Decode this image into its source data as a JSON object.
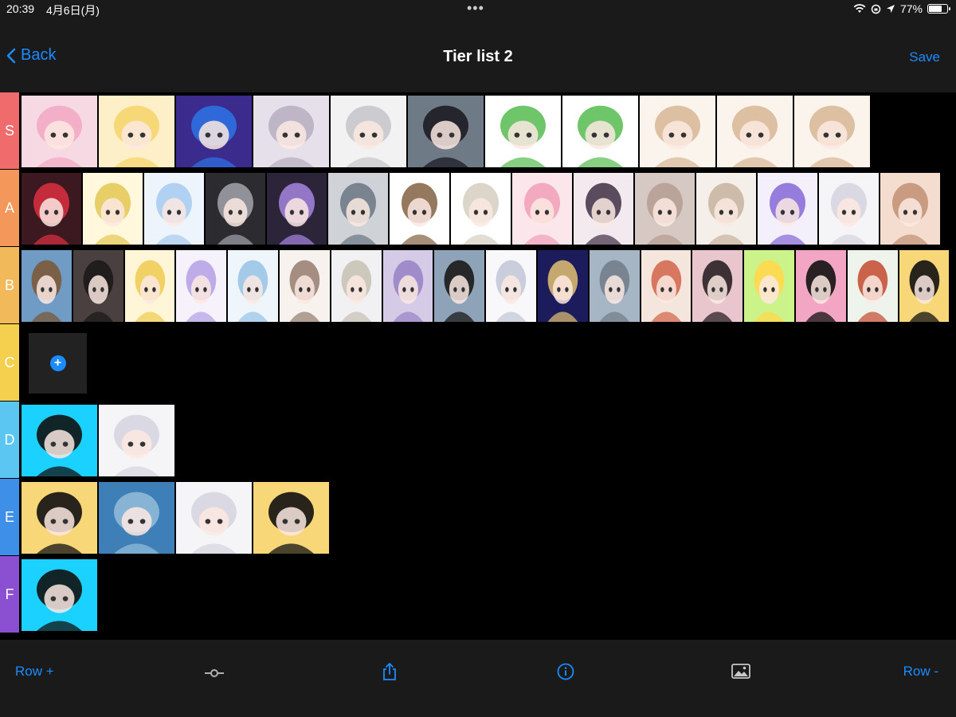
{
  "status": {
    "time": "20:39",
    "date": "4月6日(月)",
    "battery": "77%",
    "battery_level": 0.77
  },
  "nav": {
    "back": "Back",
    "title": "Tier list 2",
    "save": "Save"
  },
  "icons": {
    "back": "chevron-left-icon",
    "add": "plus-icon",
    "slider": "slider-icon",
    "share": "share-icon",
    "info": "info-icon",
    "image": "image-icon",
    "wifi": "wifi-icon",
    "orientation_lock": "orientation-lock-icon",
    "location": "location-icon",
    "battery": "battery-icon"
  },
  "tiers": [
    {
      "label": "S",
      "color": "#f06c6c",
      "items": [
        {
          "name": "pink-chibi",
          "bg": "#f7d9e4",
          "fg": "#f2a9c4"
        },
        {
          "name": "blonde-girl",
          "bg": "#fdf0c8",
          "fg": "#f6d56e"
        },
        {
          "name": "blue-haired",
          "bg": "#3a2b8c",
          "fg": "#2f6fe0"
        },
        {
          "name": "silver-haired",
          "bg": "#e6e0ea",
          "fg": "#b9b0c2"
        },
        {
          "name": "white-haired",
          "bg": "#f2f2f2",
          "fg": "#c8c8cc"
        },
        {
          "name": "photo-girl",
          "bg": "#6e7a86",
          "fg": "#1c1c24"
        },
        {
          "name": "green-dino",
          "bg": "#ffffff",
          "fg": "#5fbf5a"
        },
        {
          "name": "green-dino",
          "bg": "#ffffff",
          "fg": "#5fbf5a"
        },
        {
          "name": "bunny-girl",
          "bg": "#fbf4ec",
          "fg": "#d9b999"
        },
        {
          "name": "bunny-girl",
          "bg": "#fbf4ec",
          "fg": "#d9b999"
        },
        {
          "name": "bunny-girl",
          "bg": "#fbf4ec",
          "fg": "#d9b999"
        }
      ]
    },
    {
      "label": "A",
      "color": "#f3985a",
      "items": [
        {
          "name": "red-hair",
          "bg": "#3c1820",
          "fg": "#d32f3f"
        },
        {
          "name": "blonde-boy",
          "bg": "#fff8dc",
          "fg": "#e6c95a"
        },
        {
          "name": "light-blue",
          "bg": "#eef4fb",
          "fg": "#a9cdef"
        },
        {
          "name": "grey-wolf",
          "bg": "#2b2b30",
          "fg": "#9c9ca6"
        },
        {
          "name": "purple-dark",
          "bg": "#2c2438",
          "fg": "#9f7fd6"
        },
        {
          "name": "old-man",
          "bg": "#cfd3d8",
          "fg": "#6f7b88"
        },
        {
          "name": "brown-boy",
          "bg": "#ffffff",
          "fg": "#8a6a4e"
        },
        {
          "name": "sketch-boy",
          "bg": "#ffffff",
          "fg": "#d8d2c4"
        },
        {
          "name": "pink-angel",
          "bg": "#fbe6ec",
          "fg": "#f2a3bb"
        },
        {
          "name": "dark-bob",
          "bg": "#f3eaf0",
          "fg": "#4a3a4e"
        },
        {
          "name": "beige-girl",
          "bg": "#d6c8c2",
          "fg": "#b79f93"
        },
        {
          "name": "mint-bunny",
          "bg": "#f4efe9",
          "fg": "#c9b6a2"
        },
        {
          "name": "purple-boy",
          "bg": "#f3f0fb",
          "fg": "#8c6fd8"
        },
        {
          "name": "white-boy",
          "bg": "#f5f5f8",
          "fg": "#d7d5e0"
        },
        {
          "name": "brown-girl",
          "bg": "#f4dccf",
          "fg": "#c49478"
        }
      ]
    },
    {
      "label": "B",
      "color": "#f2b95a",
      "items": [
        {
          "name": "landscape",
          "bg": "#6f9bc4",
          "fg": "#7a5a3a"
        },
        {
          "name": "photo-girl-dark",
          "bg": "#4a4040",
          "fg": "#1e1a1a"
        },
        {
          "name": "blonde-wink",
          "bg": "#fff6d8",
          "fg": "#f0cd58"
        },
        {
          "name": "lavender-boy",
          "bg": "#f5f2fb",
          "fg": "#b7a4e6"
        },
        {
          "name": "penguin-hood",
          "bg": "#eef5fb",
          "fg": "#9bc5e8"
        },
        {
          "name": "cat-ears",
          "bg": "#f7f2ee",
          "fg": "#9b8374"
        },
        {
          "name": "blue-eye",
          "bg": "#f1f1f4",
          "fg": "#c9c3b6"
        },
        {
          "name": "purple-fluffy",
          "bg": "#d6cbe6",
          "fg": "#9a85c7"
        },
        {
          "name": "penguin",
          "bg": "#8ea2b8",
          "fg": "#1a1a1a"
        },
        {
          "name": "silver-chibi",
          "bg": "#f8f8fa",
          "fg": "#c4c8d8"
        },
        {
          "name": "night-boy",
          "bg": "#1c1c5c",
          "fg": "#d8b870"
        },
        {
          "name": "default-avatar",
          "bg": "#a7b6c4",
          "fg": "#73808c"
        },
        {
          "name": "red-hood",
          "bg": "#f4e6dc",
          "fg": "#d46a52"
        },
        {
          "name": "photo-girl-pink",
          "bg": "#e9c6cd",
          "fg": "#2a2026"
        },
        {
          "name": "sunglasses-chick",
          "bg": "#ccf38a",
          "fg": "#ffd84a"
        },
        {
          "name": "black-cat",
          "bg": "#f3a6c4",
          "fg": "#121212"
        },
        {
          "name": "red-hair-boy",
          "bg": "#eef3ec",
          "fg": "#c7533a"
        },
        {
          "name": "mickey",
          "bg": "#f7d777",
          "fg": "#111111"
        }
      ]
    },
    {
      "label": "C",
      "color": "#f5cf4e",
      "items": []
    },
    {
      "label": "D",
      "color": "#5ac6f1",
      "items": [
        {
          "name": "mickey-rainbow",
          "bg": "#1ad1ff",
          "fg": "#111111"
        },
        {
          "name": "white-boy",
          "bg": "#f5f5f8",
          "fg": "#d7d5e0"
        }
      ]
    },
    {
      "label": "E",
      "color": "#3d8fe8",
      "items": [
        {
          "name": "mickey",
          "bg": "#f7d777",
          "fg": "#111111"
        },
        {
          "name": "blue-plush",
          "bg": "#3f7fb7",
          "fg": "#8fbad8"
        },
        {
          "name": "white-boy",
          "bg": "#f5f5f8",
          "fg": "#d7d5e0"
        },
        {
          "name": "mickey",
          "bg": "#f7d777",
          "fg": "#111111"
        }
      ]
    },
    {
      "label": "F",
      "color": "#8b4fd1",
      "items": [
        {
          "name": "mickey-rainbow",
          "bg": "#1ad1ff",
          "fg": "#111111"
        }
      ]
    }
  ],
  "toolbar": {
    "row_plus": "Row +",
    "row_minus": "Row -"
  }
}
